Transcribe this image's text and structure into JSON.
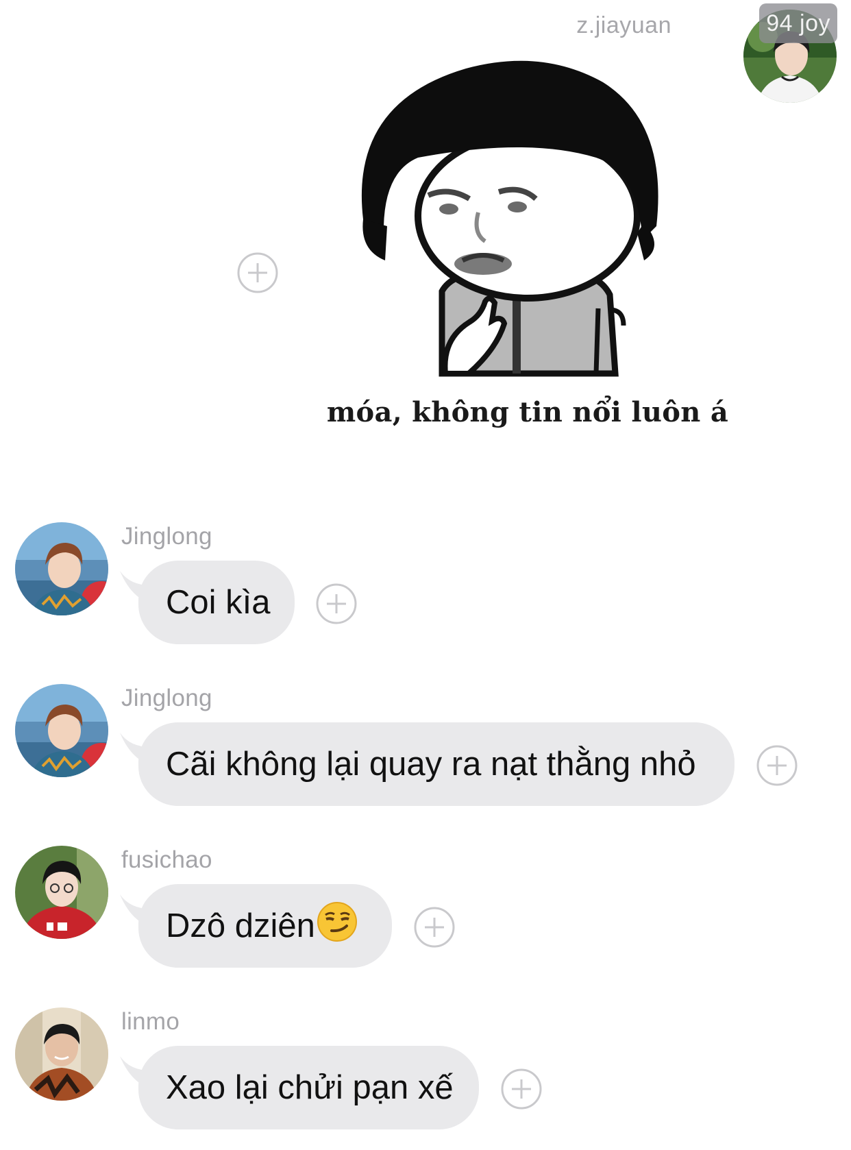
{
  "sender": {
    "name": "z.jiayuan",
    "badge": "94 joy",
    "sticker_caption": "móa, không tin nổi luôn á"
  },
  "messages": [
    {
      "name": "Jinglong",
      "text": "Coi kìa",
      "emoji": ""
    },
    {
      "name": "Jinglong",
      "text": "Cãi không lại quay ra nạt thằng nhỏ",
      "emoji": ""
    },
    {
      "name": "fusichao",
      "text": "Dzô dziên",
      "emoji": "smirking-face-emoji"
    },
    {
      "name": "linmo",
      "text": "Xao lại chửi pạn xế",
      "emoji": ""
    }
  ],
  "icons": {
    "add_reaction": "plus-circle-icon"
  },
  "colors": {
    "bubble": "#e9e9eb",
    "name_text": "#a4a4a8",
    "badge_bg": "#8c8c91"
  }
}
